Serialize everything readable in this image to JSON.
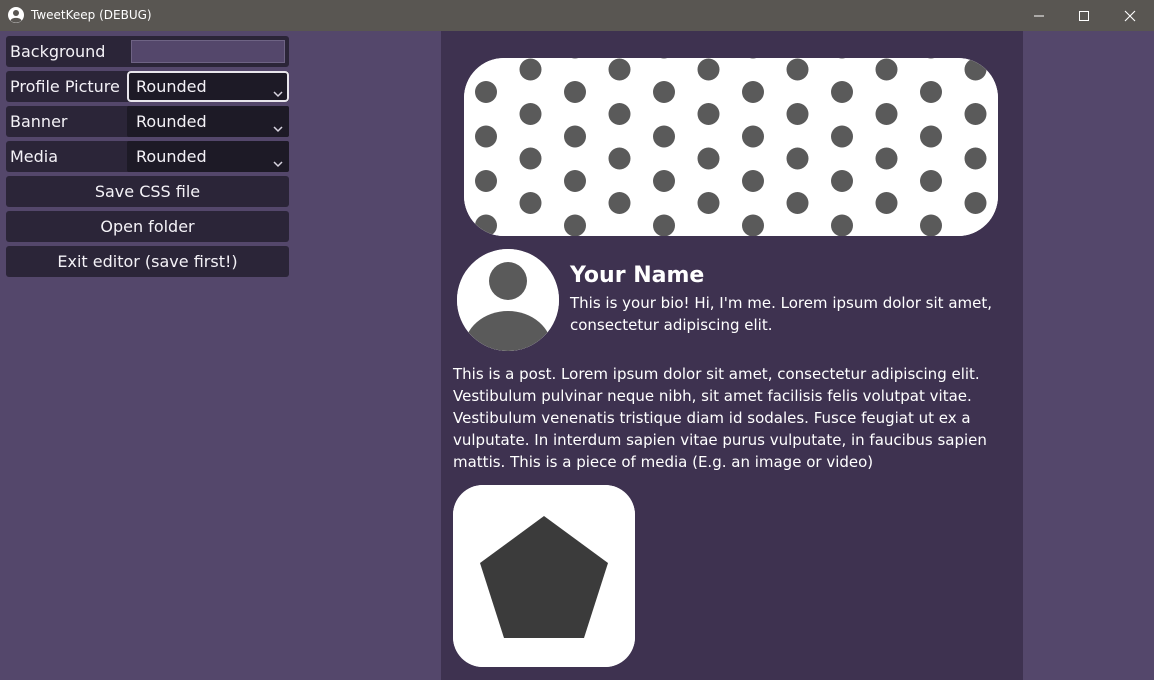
{
  "window": {
    "title": "TweetKeep (DEBUG)",
    "icons": {
      "app": "profile-icon",
      "minimize": "minimize-icon",
      "maximize": "maximize-icon",
      "close": "close-icon"
    }
  },
  "editor": {
    "background": {
      "label": "Background",
      "value_color": "#54476b"
    },
    "profile_picture": {
      "label": "Profile Picture",
      "value": "Rounded"
    },
    "banner": {
      "label": "Banner",
      "value": "Rounded"
    },
    "media": {
      "label": "Media",
      "value": "Rounded"
    },
    "buttons": {
      "save_css": "Save CSS file",
      "open_folder": "Open folder",
      "exit_editor": "Exit editor (save first!)"
    }
  },
  "preview": {
    "name": "Your Name",
    "bio": "This is your bio! Hi, I'm me. Lorem ipsum dolor sit amet, consectetur adipiscing elit.",
    "post": "This is a post. Lorem ipsum dolor sit amet, consectetur adipiscing elit. Vestibulum pulvinar neque nibh, sit amet facilisis felis volutpat vitae. Vestibulum venenatis tristique diam id sodales. Fusce feugiat ut ex a vulputate. In interdum sapien vitae purus vulputate, in faucibus sapien mattis. This is a piece of media (E.g. an image or video)",
    "banner_image": "polka-dot-pattern",
    "avatar_image": "default-avatar-icon",
    "media_image": "pentagon-shape"
  },
  "colors": {
    "page_background": "#54476b",
    "preview_background": "#3e3250",
    "control_background": "#2b2538",
    "select_background": "#1d1a26",
    "placeholder_gray": "#5a5a5a"
  }
}
